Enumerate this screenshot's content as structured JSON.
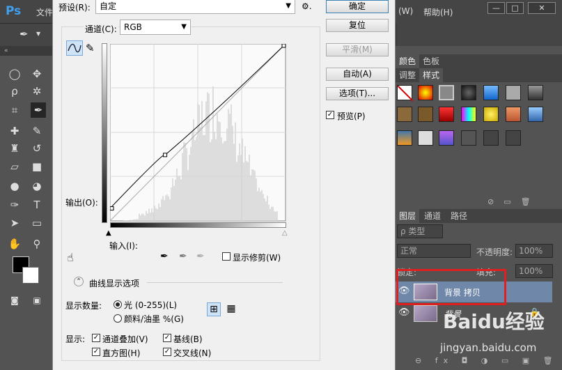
{
  "app": {
    "logo": "Ps",
    "menu_file": "文件",
    "menu_window": "(W)",
    "menu_help": "帮助(H)",
    "win_min": "—",
    "win_max": "□",
    "win_close": "✕"
  },
  "dialog": {
    "preset_label": "预设(R):",
    "preset_value": "自定",
    "gear": "⚙.",
    "channel_label": "通道(C):",
    "channel_value": "RGB",
    "buttons": {
      "ok": "确定",
      "reset": "复位",
      "smooth": "平滑(M)",
      "auto": "自动(A)",
      "options": "选项(T)..."
    },
    "preview": "预览(P)",
    "output_label": "输出(O):",
    "input_label": "输入(I):",
    "show_clipping": "显示修剪(W)",
    "curve_display_options": "曲线显示选项",
    "show_amount_label": "显示数量:",
    "light": "光 (0-255)(L)",
    "pigment": "颜料/油墨 %(G)",
    "show_label": "显示:",
    "channel_overlay": "通道叠加(V)",
    "baseline": "基线(B)",
    "histogram": "直方图(H)",
    "intersection": "交叉线(N)"
  },
  "panels": {
    "tab_color": "颜色",
    "tab_swatches": "色板",
    "tab_adjust": "调整",
    "tab_styles": "样式",
    "tab_layers": "图层",
    "tab_channels": "通道",
    "tab_paths": "路径",
    "kind_label": "ρ 类型",
    "blend_mode": "正常",
    "opacity_label": "不透明度:",
    "opacity_value": "100%",
    "lock_label": "锁定:",
    "fill_label": "填充:",
    "fill_value": "100%",
    "layer_copy": "背景 拷贝",
    "layer_bg": "背景",
    "bottom_icons": "⊖ fx ◘ ◑ ▭ ▣ 🗑"
  },
  "watermark": {
    "brand": "Baidu经验",
    "url": "jingyan.baidu.com"
  },
  "curve": {
    "points": [
      [
        0,
        18
      ],
      [
        80,
        95
      ],
      [
        255,
        255
      ]
    ],
    "highlight_color": "#e02020"
  }
}
